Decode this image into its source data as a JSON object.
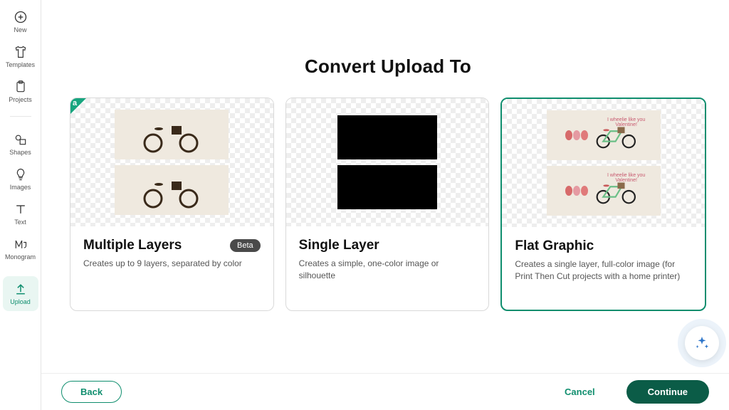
{
  "sidebar": {
    "items": [
      {
        "label": "New",
        "icon": "plus-circle-icon"
      },
      {
        "label": "Templates",
        "icon": "tshirt-icon"
      },
      {
        "label": "Projects",
        "icon": "clipboard-icon"
      },
      {
        "label": "Shapes",
        "icon": "shapes-icon"
      },
      {
        "label": "Images",
        "icon": "bulb-icon"
      },
      {
        "label": "Text",
        "icon": "text-icon"
      },
      {
        "label": "Monogram",
        "icon": "monogram-icon"
      },
      {
        "label": "Upload",
        "icon": "upload-icon"
      }
    ],
    "active_index": 7
  },
  "heading": "Convert Upload To",
  "cards": [
    {
      "title": "Multiple Layers",
      "badge": "Beta",
      "desc": "Creates up to 9 layers, separated by color",
      "selected": false,
      "flag": true
    },
    {
      "title": "Single Layer",
      "badge": "",
      "desc": "Creates a simple, one-color image or silhouette",
      "selected": false,
      "flag": false
    },
    {
      "title": "Flat Graphic",
      "badge": "",
      "desc": "Creates a single layer, full-color image (for Print Then Cut projects with a home printer)",
      "selected": true,
      "flag": false
    }
  ],
  "color_card_caption": "I wheelie like you Valentine!",
  "footer": {
    "back": "Back",
    "cancel": "Cancel",
    "continue": "Continue"
  },
  "colors": {
    "accent": "#0f8e6e",
    "primary_btn": "#0b5c47"
  }
}
